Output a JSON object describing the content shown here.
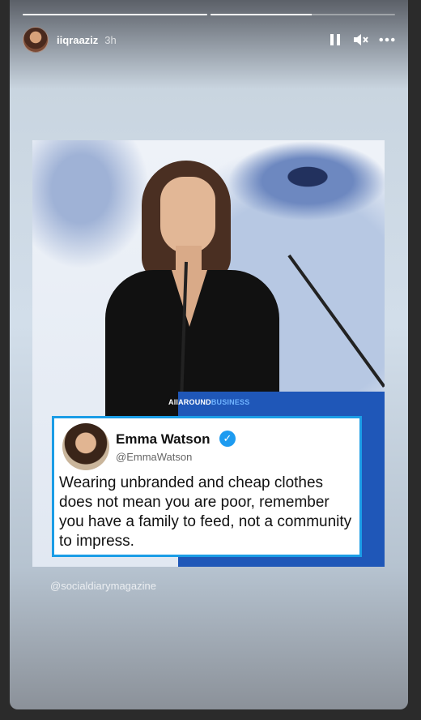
{
  "story": {
    "progress": [
      1.0,
      0.55
    ],
    "username": "iiqraaziz",
    "time": "3h",
    "icons": {
      "pause": "pause-icon",
      "mute": "mute-icon",
      "more": "more-icon"
    }
  },
  "post": {
    "brand_a": "AllAROUND",
    "brand_b": "BUSINESS",
    "tweet": {
      "name": "Emma Watson",
      "handle": "@EmmaWatson",
      "text": "Wearing unbranded and cheap clothes does not mean you are poor, remember you have a family to feed, not a community to impress."
    }
  },
  "watermark": "@socialdiarymagazine"
}
